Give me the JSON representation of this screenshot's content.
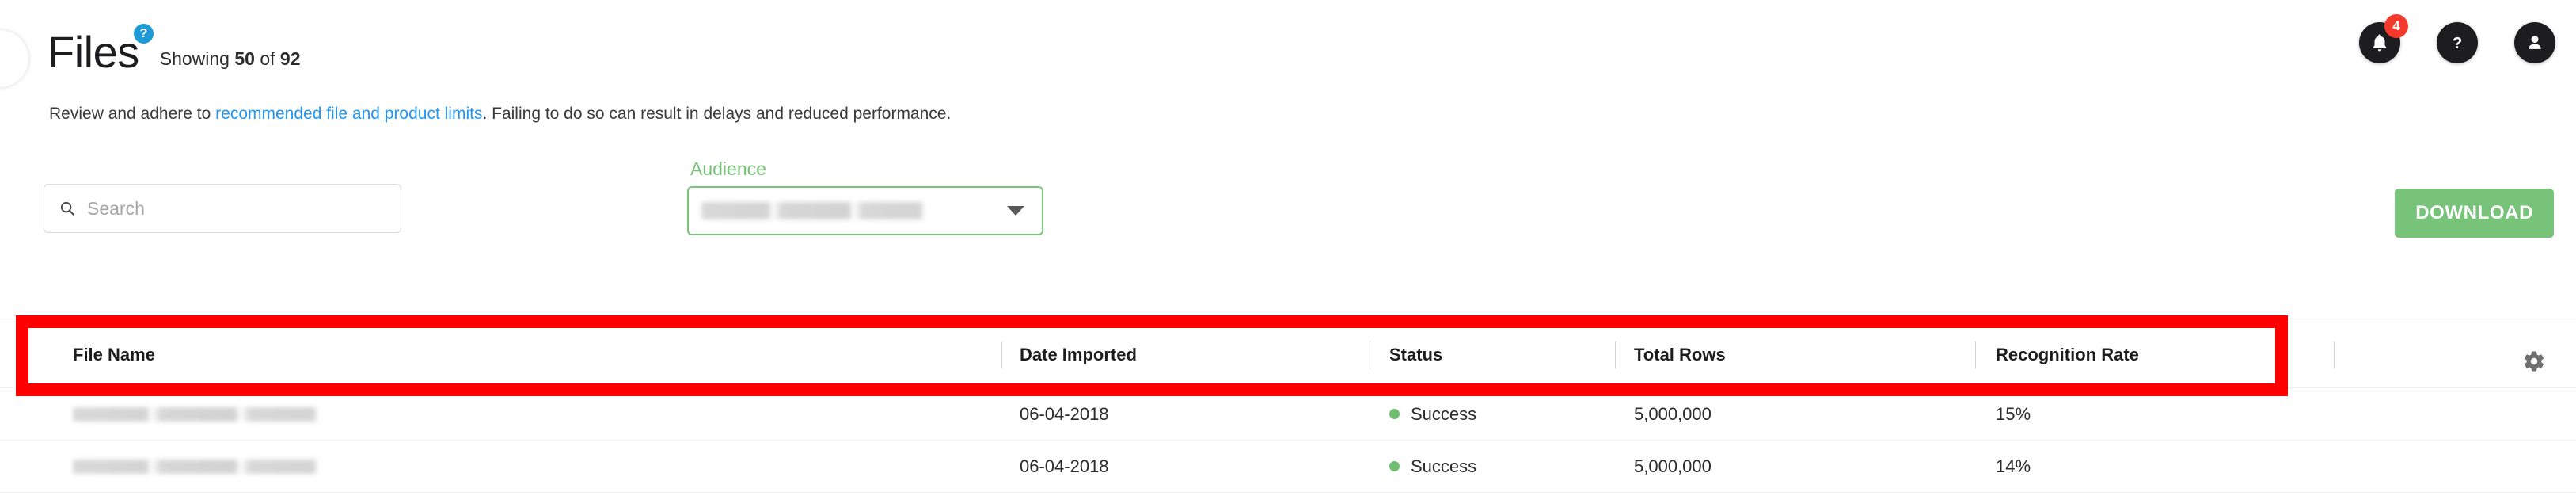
{
  "header": {
    "title": "Files",
    "help_badge": "?",
    "showing_prefix": "Showing",
    "showing_count": "50",
    "showing_middle": "of",
    "showing_total": "92",
    "notifications_count": "4",
    "icons": {
      "bell": "bell-icon",
      "help": "help-icon",
      "account": "account-icon"
    }
  },
  "description": {
    "before_link": "Review and adhere to ",
    "link_text": "recommended file and product limits",
    "after_link": ". Failing to do so can result in delays and reduced performance.",
    "link_color": "#2196f3"
  },
  "filters": {
    "search": {
      "placeholder": "Search",
      "value": ""
    },
    "audience": {
      "label": "Audience",
      "value": "",
      "redacted": true,
      "border_color": "#7ac47c",
      "label_color": "#77c178"
    }
  },
  "actions": {
    "download_label": "DOWNLOAD",
    "download_color": "#78c37a",
    "settings_icon": "gear-icon"
  },
  "table": {
    "columns": [
      {
        "key": "file_name",
        "label": "File Name"
      },
      {
        "key": "date_imported",
        "label": "Date Imported"
      },
      {
        "key": "status",
        "label": "Status"
      },
      {
        "key": "total_rows",
        "label": "Total Rows"
      },
      {
        "key": "recognition_rate",
        "label": "Recognition Rate"
      }
    ],
    "rows": [
      {
        "file_name": "",
        "file_name_redacted": true,
        "date_imported": "06-04-2018",
        "status": "Success",
        "status_color": "#6ebe6f",
        "total_rows": "5,000,000",
        "recognition_rate": "15%"
      },
      {
        "file_name": "",
        "file_name_redacted": true,
        "date_imported": "06-04-2018",
        "status": "Success",
        "status_color": "#6ebe6f",
        "total_rows": "5,000,000",
        "recognition_rate": "14%"
      }
    ]
  },
  "annotation": {
    "type": "highlight-rectangle",
    "color": "#fe0000",
    "target": "table-header-row"
  }
}
